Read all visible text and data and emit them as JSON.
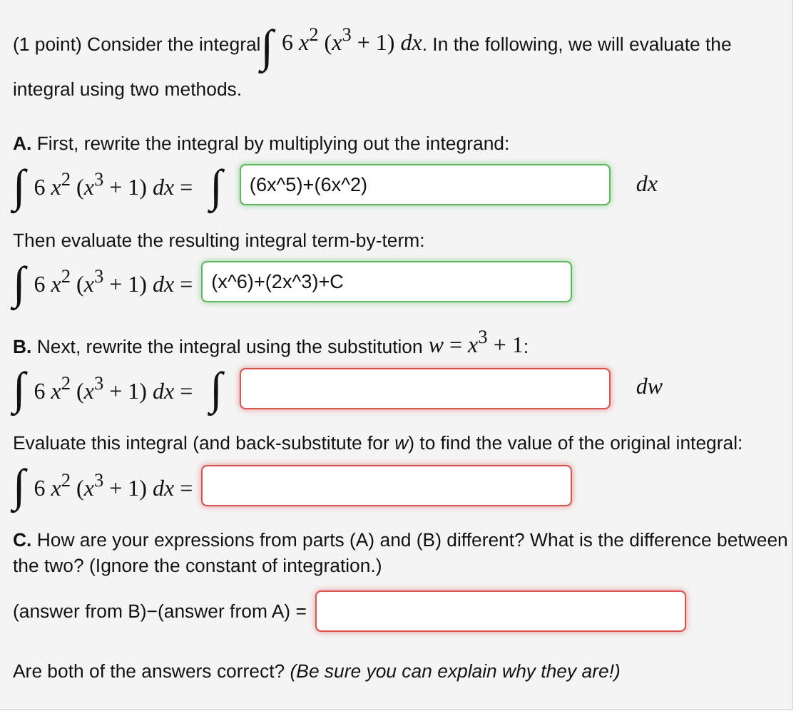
{
  "intro": {
    "before": "(1 point) Consider the integral",
    "integral_sign": "∫",
    "math": "6 *x*$^{2}$ (*x*$^{3}$ + 1) *dx*",
    "after": ". In the following, we will evaluate the integral using two methods."
  },
  "blocks": [
    {
      "kind": "heading",
      "label": "A.",
      "text": "First, rewrite the integral by multiplying out the integrand:"
    },
    {
      "kind": "equation",
      "lhs_sign": "∫",
      "lhs": "6 *x*$^{2}$ (*x*$^{3}$ + 1) *dx* =",
      "rhs_sign": "∫",
      "field": {
        "value": "(6x^5)+(6x^2)",
        "correct": true
      },
      "suffix": "*dx*"
    },
    {
      "kind": "text",
      "text": "Then evaluate the resulting integral term-by-term:"
    },
    {
      "kind": "equation",
      "lhs_sign": "∫",
      "lhs": "6 *x*$^{2}$ (*x*$^{3}$ + 1) *dx* =",
      "field": {
        "value": "(x^6)+(2x^3)+C",
        "correct": true
      }
    },
    {
      "kind": "heading",
      "label": "B.",
      "text": "Next, rewrite the integral using the substitution",
      "math": "*w* = *x*$^{3}$ + 1",
      "after": ":"
    },
    {
      "kind": "equation",
      "lhs_sign": "∫",
      "lhs": "6 *x*$^{2}$ (*x*$^{3}$ + 1) *dx* =",
      "rhs_sign": "∫",
      "field": {
        "correct": false
      },
      "suffix": "*dw*"
    },
    {
      "kind": "text",
      "text": "Evaluate this integral (and back-substitute for *w*) to find the value of the original integral:"
    },
    {
      "kind": "equation",
      "lhs_sign": "∫",
      "lhs": "6 *x*$^{2}$ (*x*$^{3}$ + 1) *dx* =",
      "field": {
        "correct": false
      }
    },
    {
      "kind": "heading",
      "label": "C.",
      "text": "How are your expressions from parts (A) and (B) different? What is the difference between the two? (Ignore the constant of integration.)"
    },
    {
      "kind": "labeled_field",
      "label": "(answer from B)−(answer from A) =",
      "field": {
        "correct": false
      }
    },
    {
      "kind": "note",
      "text": "Are both of the answers correct? *(Be sure you can explain why they are!)*"
    }
  ]
}
